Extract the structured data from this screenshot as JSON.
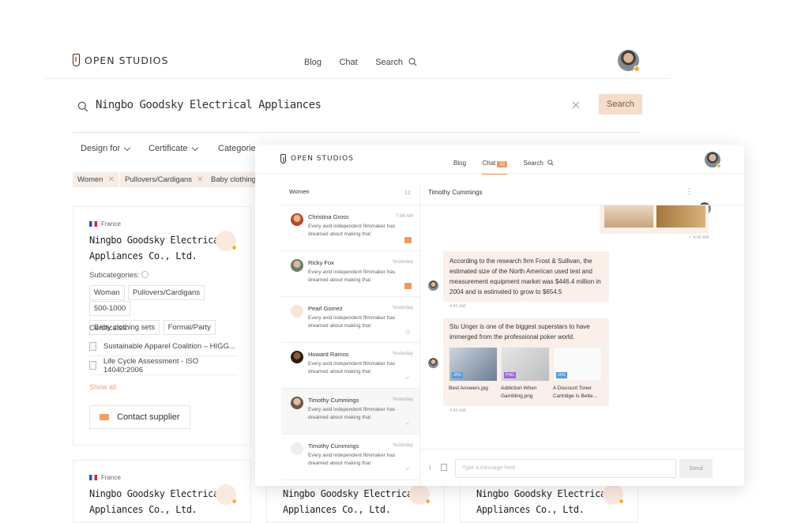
{
  "app": {
    "brand": "OPEN STUDIOS"
  },
  "nav": {
    "blog": "Blog",
    "chat": "Chat",
    "search": "Search"
  },
  "search": {
    "query": "Ningbo Goodsky Electrical Appliances",
    "button": "Search"
  },
  "filters": [
    "Design for",
    "Certificate",
    "Categories"
  ],
  "tags": [
    "Women",
    "Pullovers/Cardigans",
    "Baby clothing"
  ],
  "card": {
    "country": "France",
    "company_line1": "Ningbo Goodsky Electrical",
    "company_line2": "Appliances Co., Ltd.",
    "subcategories_label": "Subcategories:",
    "chips": [
      "Woman",
      "Pullovers/Cardigans",
      "500-1000",
      "Baby clothing sets",
      "Formal/Party"
    ],
    "certificates_label": "Certificates:",
    "certificates": [
      "Sustainable Apparel Coalition – HIGG...",
      "Life Cycle Assessment - ISO 14040:2006"
    ],
    "show_all": "Show all",
    "contact": "Contact supplier"
  },
  "card2": {
    "country": "France",
    "company_line1": "Ningbo Goodsky Electrical",
    "company_line2": "Appliances Co., Ltd."
  },
  "card3": {
    "company_line1": "Ningbo Goodsky Electrical",
    "company_line2": "Appliances Co., Ltd."
  },
  "card4": {
    "company_line1": "Ningbo Goodsky Electrical",
    "company_line2": "Appliances Co., Ltd."
  },
  "chat": {
    "badge": "12",
    "list_title": "Women",
    "list_count": "12",
    "active_contact": "Timothy Cummings",
    "conversations": [
      {
        "name": "Christina Gross",
        "time": "7:48 AM",
        "preview": "Every avid independent filmmaker has dreamed about making that"
      },
      {
        "name": "Ricky Fox",
        "time": "Yesterday",
        "preview": "Every avid independent filmmaker has dreamed about making that"
      },
      {
        "name": "Pearl Gomez",
        "time": "Yesterday",
        "preview": "Every avid independent filmmaker has dreamed about making that"
      },
      {
        "name": "Howard Ramos",
        "time": "Yesterday",
        "preview": "Every avid independent filmmaker has dreamed about making that"
      },
      {
        "name": "Timothy Cummings",
        "time": "Yesterday",
        "preview": "Every avid independent filmmaker has dreamed about making that"
      },
      {
        "name": "Timothy Cummings",
        "time": "Yesterday",
        "preview": "Every avid independent filmmaker has dreamed about making that"
      }
    ],
    "messages": [
      {
        "time": "4:45 AM"
      },
      {
        "text": "According to the research firm Frost & Sullivan, the estimated size of the North American used test and measurement equipment market was $446.4 million in 2004 and is estimated to grow to $654.5",
        "time": "4:45 AM"
      },
      {
        "text": "Stu Unger is one of the biggest superstars to have immerged from the professional poker world.",
        "time": "4:45 AM"
      }
    ],
    "attachments": [
      {
        "name": "Best Answers.jpg",
        "ext": "JPG"
      },
      {
        "name": "Addiction When Gambling.png",
        "ext": "PNG"
      },
      {
        "name": "A Discount Toner Cartridge Is Bette...",
        "ext": "JPG"
      }
    ],
    "input_placeholder": "Type a message here",
    "send": "Send"
  },
  "colors": {
    "accent": "#f09a60",
    "tag_bg": "#f5eee8",
    "bubble": "#fbf0e9"
  }
}
